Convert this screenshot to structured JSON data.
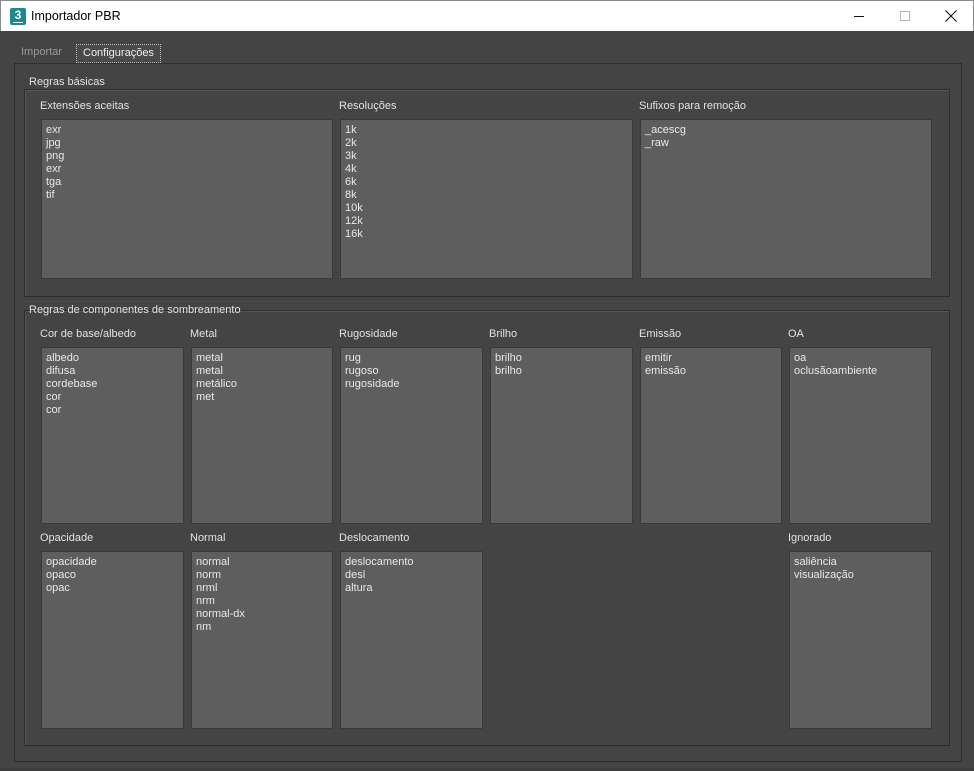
{
  "window": {
    "icon_glyph": "3",
    "title": "Importador PBR"
  },
  "tabs": [
    {
      "label": "Importar",
      "active": false
    },
    {
      "label": "Configurações",
      "active": true
    }
  ],
  "basic_rules": {
    "title": "Regras básicas",
    "extensions": {
      "label": "Extensões aceitas",
      "items": [
        "exr",
        "jpg",
        "png",
        "exr",
        "tga",
        "tif"
      ]
    },
    "resolutions": {
      "label": "Resoluções",
      "items": [
        "1k",
        "2k",
        "3k",
        "4k",
        "6k",
        "8k",
        "10k",
        "12k",
        "16k"
      ]
    },
    "suffixes": {
      "label": "Sufixos para remoção",
      "items": [
        "_acescg",
        "_raw"
      ]
    }
  },
  "shading_rules": {
    "title": "Regras de componentes de sombreamento",
    "base_color": {
      "label": "Cor de base/albedo",
      "items": [
        "albedo",
        "difusa",
        "cordebase",
        "cor",
        "cor"
      ]
    },
    "metal": {
      "label": "Metal",
      "items": [
        "metal",
        "metal",
        "metálico",
        "met"
      ]
    },
    "roughness": {
      "label": "Rugosidade",
      "items": [
        "rug",
        "rugoso",
        "rugosidade"
      ]
    },
    "gloss": {
      "label": "Brilho",
      "items": [
        "brilho",
        "brilho"
      ]
    },
    "emission": {
      "label": "Emissão",
      "items": [
        "emitir",
        "emissão"
      ]
    },
    "ao": {
      "label": "OA",
      "items": [
        "oa",
        "oclusãoambiente"
      ]
    },
    "opacity": {
      "label": "Opacidade",
      "items": [
        "opacidade",
        "opaco",
        "opac"
      ]
    },
    "normal": {
      "label": "Normal",
      "items": [
        "normal",
        "norm",
        "nrml",
        "nrm",
        "normal-dx",
        "nm"
      ]
    },
    "displacement": {
      "label": "Deslocamento",
      "items": [
        "deslocamento",
        "desl",
        "altura"
      ]
    },
    "ignored": {
      "label": "Ignorado",
      "items": [
        "saliência",
        "visualização"
      ]
    }
  }
}
